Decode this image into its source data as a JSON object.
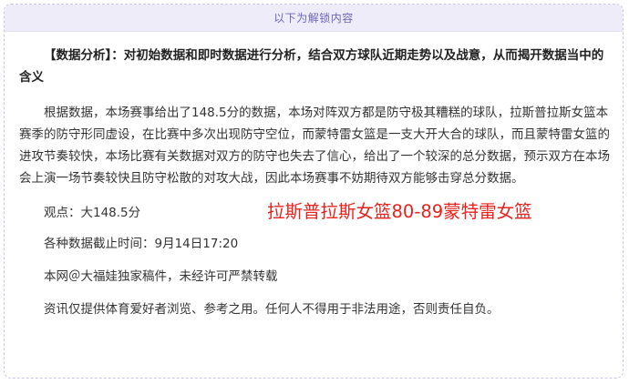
{
  "banner": {
    "unlock_label": "以下为解锁内容"
  },
  "article": {
    "analysis_title": "【数据分析】：对初始数据和即时数据进行分析，结合双方球队近期走势以及战意，从而揭开数据当中的含义",
    "analysis_body": "根据数据，本场赛事给出了148.5分的数据，本场对阵双方都是防守极其糟糕的球队，拉斯普拉斯女篮本赛季的防守形同虚设，在比赛中多次出现防守空位，而蒙特雷女篮是一支大开大合的球队，而且蒙特雷女篮的进攻节奏较快，本场比赛有关数据对双方的防守也失去了信心，给出了一个较深的总分数据，预示双方在本场会上演一场节奏较快且防守松散的对攻大战，因此本场赛事不妨期待双方能够击穿总分数据。",
    "viewpoint": "观点：大148.5分",
    "match_title": "拉斯普拉斯女篮80-89蒙特雷女篮",
    "data_cutoff": "各种数据截止时间：9月14日17:20",
    "copyright": "本网＠大福娃独家稿件，未经许可严禁转载",
    "disclaimer": "资讯仅提供体育爱好者浏览、参考之用。任何人不得用于非法用途，否则责任自负。"
  },
  "colors": {
    "banner_bg": "#edecf8",
    "banner_text": "#6d67b8",
    "border": "#c9c6e6",
    "match_title": "#e8211c"
  }
}
